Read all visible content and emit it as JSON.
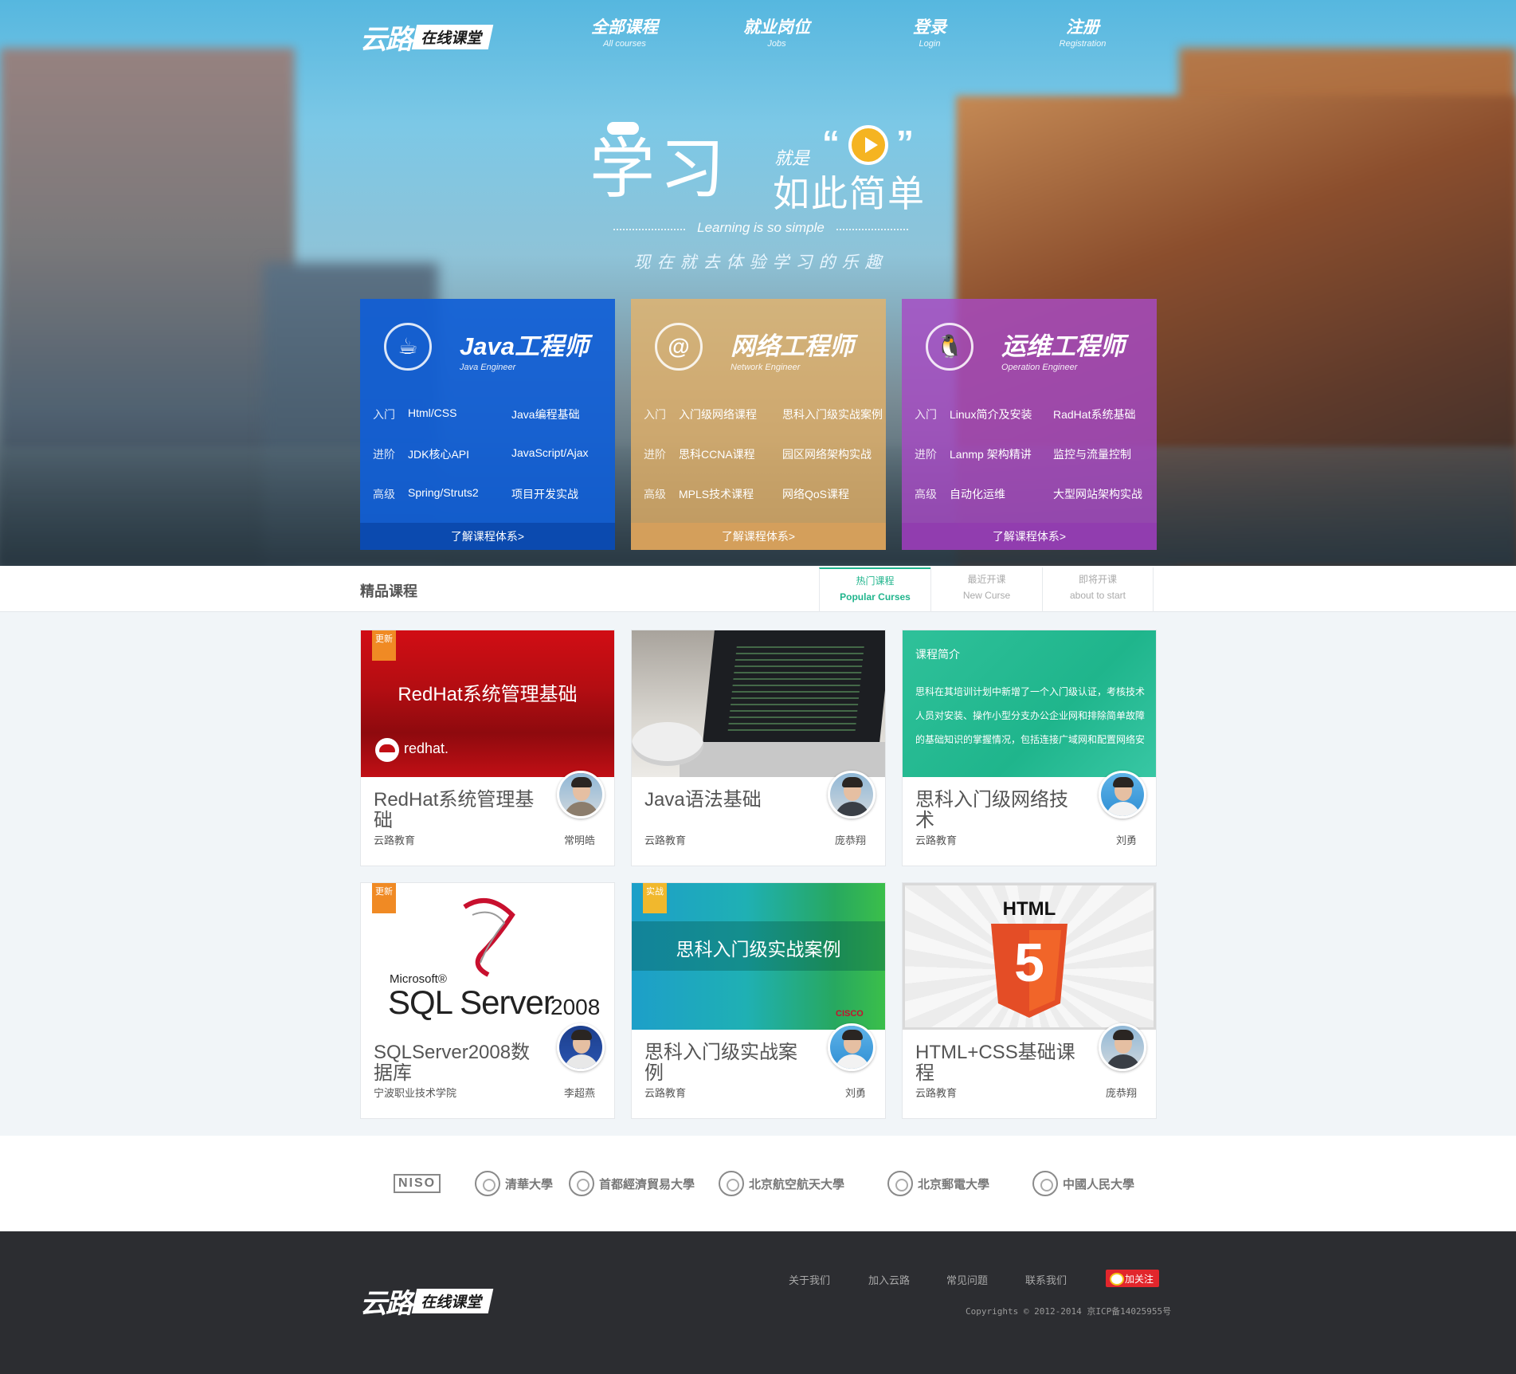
{
  "brand": {
    "mark": "云路",
    "tag": "在线课堂"
  },
  "nav": [
    {
      "cn": "全部课程",
      "en": "All courses"
    },
    {
      "cn": "就业岗位",
      "en": "Jobs"
    },
    {
      "cn": "登录",
      "en": "Login"
    },
    {
      "cn": "注册",
      "en": "Registration"
    }
  ],
  "hero": {
    "slogan_big": "学习",
    "slogan_small1": "就是",
    "slogan_small2": "如此简单",
    "quote_left": "“",
    "quote_right": "”",
    "slogan_en": "Learning is so simple",
    "slogan_sub": "现在就去体验学习的乐趣"
  },
  "categories": [
    {
      "title": "Java工程师",
      "title_en": "Java Engineer",
      "icon": "java-cup-icon",
      "icon_glyph": "☕",
      "rows": [
        {
          "level": "入门",
          "a": "Html/CSS",
          "b": "Java编程基础"
        },
        {
          "level": "进阶",
          "a": "JDK核心API",
          "b": "JavaScript/Ajax"
        },
        {
          "level": "高级",
          "a": "Spring/Struts2",
          "b": "项目开发实战"
        }
      ],
      "more": "了解课程体系>",
      "color": "#105ed6"
    },
    {
      "title": "网络工程师",
      "title_en": "Network Engineer",
      "icon": "at-sign-icon",
      "icon_glyph": "@",
      "rows": [
        {
          "level": "入门",
          "a": "入门级网络课程",
          "b": "思科入门级实战案例"
        },
        {
          "level": "进阶",
          "a": "思科CCNA课程",
          "b": "园区网络架构实战"
        },
        {
          "level": "高级",
          "a": "MPLS技术课程",
          "b": "网络QoS课程"
        }
      ],
      "more": "了解课程体系>",
      "color": "#e8b468"
    },
    {
      "title": "运维工程师",
      "title_en": "Operation Engineer",
      "icon": "penguin-icon",
      "icon_glyph": "🐧",
      "rows": [
        {
          "level": "入门",
          "a": "Linux简介及安装",
          "b": "RadHat系统基础"
        },
        {
          "level": "进阶",
          "a": "Lanmp 架构精讲",
          "b": "监控与流量控制"
        },
        {
          "level": "高级",
          "a": "自动化运维",
          "b": "大型网站架构实战"
        }
      ],
      "more": "了解课程体系>",
      "color": "#a74ac4"
    }
  ],
  "section": {
    "title": "精品课程"
  },
  "tabs": [
    {
      "cn": "热门课程",
      "en": "Popular Curses",
      "active": true
    },
    {
      "cn": "最近开课",
      "en": "New Curse",
      "active": false
    },
    {
      "cn": "即将开课",
      "en": "about to start",
      "active": false
    }
  ],
  "courses": [
    {
      "name": "RedHat系统管理基础",
      "org": "云路教育",
      "teacher": "常明皓",
      "badge": "更新",
      "thumb_title": "RedHat系统管理基础",
      "thumb_brand": "redhat."
    },
    {
      "name": "Java语法基础",
      "org": "云路教育",
      "teacher": "庞恭翔",
      "badge": ""
    },
    {
      "name": "思科入门级网络技术",
      "org": "云路教育",
      "teacher": "刘勇",
      "badge": "",
      "thumb_title": "课程简介",
      "thumb_text": "思科在其培训计划中新增了一个入门级认证，考核技术人员对安装、操作小型分支办公企业网和排除简单故障的基础知识的掌握情况，包括连接广域网和配置网络安"
    },
    {
      "name": "SQLServer2008数据库",
      "org": "宁波职业技术学院",
      "teacher": "李超燕",
      "badge": "更新",
      "thumb_brand": "Microsoft®",
      "thumb_title": "SQL Server",
      "thumb_version": "2008"
    },
    {
      "name": "思科入门级实战案例",
      "org": "云路教育",
      "teacher": "刘勇",
      "badge": "实战",
      "thumb_title": "思科入门级实战案例",
      "thumb_brand": "CISCO"
    },
    {
      "name": "HTML+CSS基础课程",
      "org": "云路教育",
      "teacher": "庞恭翔",
      "badge": "",
      "thumb_title": "HTML",
      "thumb_number": "5"
    }
  ],
  "partners": [
    {
      "name": "NISO"
    },
    {
      "name": "清華大學"
    },
    {
      "name": "首都經濟貿易大學"
    },
    {
      "name": "北京航空航天大學"
    },
    {
      "name": "北京郵電大學"
    },
    {
      "name": "中國人民大學"
    }
  ],
  "footer": {
    "links": [
      "关于我们",
      "加入云路",
      "常见问题",
      "联系我们"
    ],
    "follow": "加关注",
    "copyright": "Copyrights © 2012-2014 京ICP备14025955号"
  },
  "colors": {
    "accent": "#21b58d",
    "java": "#105ed6",
    "network": "#e8b468",
    "ops": "#a74ac4",
    "footer": "#2c2d31"
  }
}
